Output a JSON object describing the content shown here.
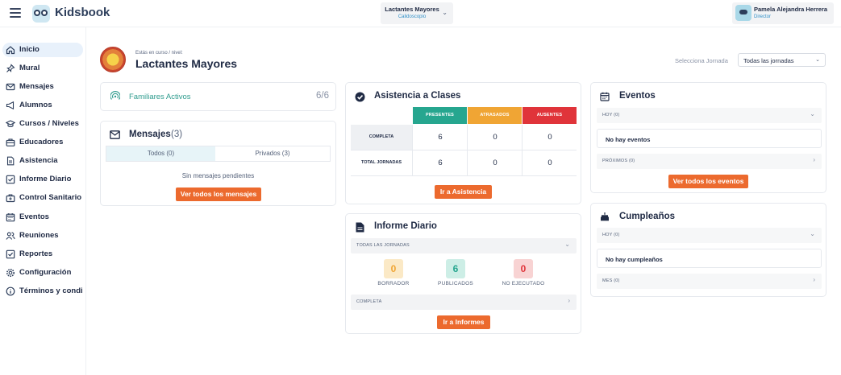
{
  "header": {
    "app_name": "Kidsbook",
    "course_selector": {
      "course": "Lactantes Mayores",
      "school": "Calidoscopio"
    },
    "user": {
      "name": "Pamela Alejandra Herrera",
      "role": "Director"
    }
  },
  "sidebar": {
    "items": [
      {
        "label": "Inicio",
        "icon": "home-icon",
        "active": true
      },
      {
        "label": "Mural",
        "icon": "pin-icon"
      },
      {
        "label": "Mensajes",
        "icon": "mail-icon"
      },
      {
        "label": "Alumnos",
        "icon": "megaphone-icon"
      },
      {
        "label": "Cursos / Niveles",
        "icon": "graduation-cap-icon"
      },
      {
        "label": "Educadores",
        "icon": "briefcase-icon"
      },
      {
        "label": "Asistencia",
        "icon": "document-icon"
      },
      {
        "label": "Informe Diario",
        "icon": "checkbox-icon"
      },
      {
        "label": "Control Sanitario",
        "icon": "medical-bag-icon"
      },
      {
        "label": "Eventos",
        "icon": "calendar-icon"
      },
      {
        "label": "Reuniones",
        "icon": "people-icon"
      },
      {
        "label": "Reportes",
        "icon": "checkbox-icon"
      },
      {
        "label": "Configuración",
        "icon": "gear-icon"
      },
      {
        "label": "Términos y condiciones",
        "icon": "info-icon"
      }
    ]
  },
  "page": {
    "course_subtitle": "Estás en curso / nivel:",
    "course_title": "Lactantes Mayores",
    "jornada_label": "Selecciona Jornada",
    "jornada_value": "Todas las jornadas"
  },
  "familiares": {
    "label": "Familiares Activos",
    "count": "6/6"
  },
  "mensajes": {
    "title": "Mensajes",
    "count": "(3)",
    "tabs": [
      "Todos (0)",
      "Privados (3)"
    ],
    "empty": "Sin mensajes pendientes",
    "button": "Ver todos los mensajes"
  },
  "asistencia": {
    "title": "Asistencia a Clases",
    "columns": [
      {
        "label": "PRESENTES",
        "color": "#26a68f"
      },
      {
        "label": "ATRASADOS",
        "color": "#f0a534"
      },
      {
        "label": "AUSENTES",
        "color": "#e0343a"
      }
    ],
    "rows": [
      {
        "label": "COMPLETA",
        "values": [
          "6",
          "0",
          "0"
        ]
      },
      {
        "label": "TOTAL JORNADAS",
        "values": [
          "6",
          "0",
          "0"
        ]
      }
    ],
    "button": "Ir a Asistencia"
  },
  "informe": {
    "title": "Informe Diario",
    "filter": "TODAS LAS JORNADAS",
    "stats": [
      {
        "value": "0",
        "label": "BORRADOR",
        "bg": "#fbe9c6",
        "fg": "#f0a534"
      },
      {
        "value": "6",
        "label": "PUBLICADOS",
        "bg": "#cdeee6",
        "fg": "#26a68f"
      },
      {
        "value": "0",
        "label": "NO EJECUTADO",
        "bg": "#f8d3d3",
        "fg": "#e0343a"
      }
    ],
    "row": "COMPLETA",
    "button": "Ir a Informes"
  },
  "eventos": {
    "title": "Eventos",
    "today_label": "HOY (0)",
    "today_empty": "No hay eventos",
    "upcoming_label": "PRÓXIMOS (0)",
    "button": "Ver todos los eventos"
  },
  "cumpleanos": {
    "title": "Cumpleaños",
    "today_label": "HOY (0)",
    "today_empty": "No hay cumpleaños",
    "month_label": "MES (0)"
  }
}
